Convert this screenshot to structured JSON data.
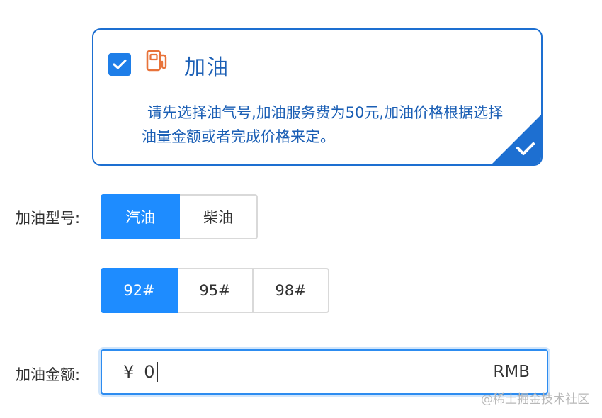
{
  "service": {
    "checked": true,
    "icon": "fuel-pump-icon",
    "title": "加油",
    "description": "请先选择油气号,加油服务费为50元,加油价格根据选择油量金额或者完成价格来定。",
    "selected_corner_icon": "check-icon"
  },
  "fuel_type": {
    "label": "加油型号:",
    "options": [
      "汽油",
      "柴油"
    ],
    "selected": "汽油"
  },
  "grade": {
    "options": [
      "92#",
      "95#",
      "98#"
    ],
    "selected": "92#"
  },
  "amount": {
    "label": "加油金额:",
    "prefix": "¥",
    "value": "0",
    "suffix": "RMB"
  },
  "watermark": "@稀土掘金技术社区",
  "colors": {
    "primary": "#1e8cff",
    "card_border": "#1d6fd1",
    "card_text": "#1b5fb5",
    "icon_orange": "#e8733a"
  }
}
